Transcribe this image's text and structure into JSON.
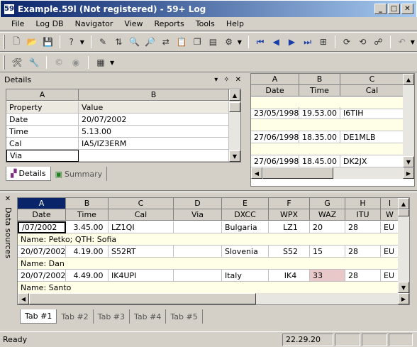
{
  "window": {
    "title": "Example.59l (Not registered) - 59+ Log",
    "app_icon": "59"
  },
  "menu": [
    "File",
    "Log DB",
    "Navigator",
    "View",
    "Reports",
    "Tools",
    "Help"
  ],
  "details": {
    "title": "Details",
    "col_a": "A",
    "col_b": "B",
    "rows": [
      {
        "property": "Property",
        "value": "Value"
      },
      {
        "property": "Date",
        "value": "20/07/2002"
      },
      {
        "property": "Time",
        "value": "5.13.00"
      },
      {
        "property": "Cal",
        "value": "IA5/IZ3ERM"
      },
      {
        "property": "Via",
        "value": ""
      }
    ],
    "tabs": [
      "Details",
      "Summary"
    ]
  },
  "right_grid": {
    "cols": [
      "A",
      "B",
      "C"
    ],
    "headers": [
      "Date",
      "Time",
      "Cal"
    ],
    "rows": [
      {
        "date": "23/05/1998",
        "time": "19.53.00",
        "cal": "I6TIH"
      },
      {
        "date": "27/06/1998",
        "time": "18.35.00",
        "cal": "DE1MLB"
      },
      {
        "date": "27/06/1998",
        "time": "18.45.00",
        "cal": "DK2JX"
      }
    ]
  },
  "side_label": "Data sources",
  "main_grid": {
    "cols": [
      "A",
      "B",
      "C",
      "D",
      "E",
      "F",
      "G",
      "H",
      "I"
    ],
    "headers": [
      "Date",
      "Time",
      "Cal",
      "Via",
      "DXCC",
      "WPX",
      "WAZ",
      "ITU",
      "W"
    ],
    "rows": [
      {
        "cells": [
          "/07/2002",
          "3.45.00",
          "LZ1QI",
          "",
          "Bulgaria",
          "LZ1",
          "20",
          "28",
          "EU"
        ],
        "note": "Name: Petko; QTH: Sofia"
      },
      {
        "cells": [
          "20/07/2002",
          "4.19.00",
          "S52RT",
          "",
          "Slovenia",
          "S52",
          "15",
          "28",
          "EU"
        ],
        "note": "Name: Dan"
      },
      {
        "cells": [
          "20/07/2002",
          "4.49.00",
          "IK4UPI",
          "",
          "Italy",
          "IK4",
          "33",
          "28",
          "EU"
        ],
        "note": "Name: Santo"
      }
    ],
    "tabs": [
      "Tab #1",
      "Tab #2",
      "Tab #3",
      "Tab #4",
      "Tab #5"
    ]
  },
  "statusbar": {
    "text": "Ready",
    "time": "22.29.20"
  },
  "colors": {
    "selected_col": "#0a246a",
    "waz_highlight": "#e8c8c8"
  }
}
